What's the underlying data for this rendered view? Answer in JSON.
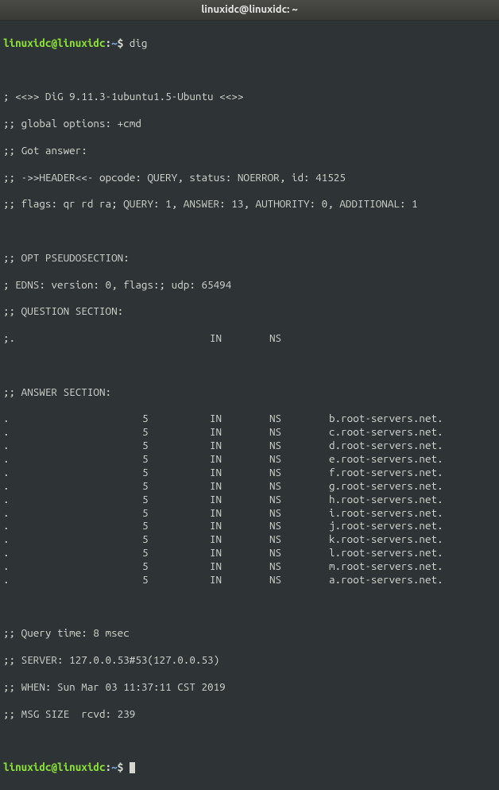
{
  "window": {
    "title": "linuxidc@linuxidc: ~"
  },
  "prompt": {
    "user_host": "linuxidc@linuxidc",
    "separator": ":",
    "path": "~",
    "symbol": "$ "
  },
  "command": "dig",
  "output": {
    "banner": "; <<>> DiG 9.11.3-1ubuntu1.5-Ubuntu <<>>",
    "global_options": ";; global options: +cmd",
    "got_answer": ";; Got answer:",
    "header": ";; ->>HEADER<<- opcode: QUERY, status: NOERROR, id: 41525",
    "flags": ";; flags: qr rd ra; QUERY: 1, ANSWER: 13, AUTHORITY: 0, ADDITIONAL: 1",
    "opt_header": ";; OPT PSEUDOSECTION:",
    "edns": "; EDNS: version: 0, flags:; udp: 65494",
    "question_header": ";; QUESTION SECTION:",
    "question_row": {
      "name": ";.",
      "class": "IN",
      "type": "NS"
    },
    "answer_header": ";; ANSWER SECTION:",
    "answers": [
      {
        "name": ".",
        "ttl": "5",
        "class": "IN",
        "type": "NS",
        "target": "b.root-servers.net."
      },
      {
        "name": ".",
        "ttl": "5",
        "class": "IN",
        "type": "NS",
        "target": "c.root-servers.net."
      },
      {
        "name": ".",
        "ttl": "5",
        "class": "IN",
        "type": "NS",
        "target": "d.root-servers.net."
      },
      {
        "name": ".",
        "ttl": "5",
        "class": "IN",
        "type": "NS",
        "target": "e.root-servers.net."
      },
      {
        "name": ".",
        "ttl": "5",
        "class": "IN",
        "type": "NS",
        "target": "f.root-servers.net."
      },
      {
        "name": ".",
        "ttl": "5",
        "class": "IN",
        "type": "NS",
        "target": "g.root-servers.net."
      },
      {
        "name": ".",
        "ttl": "5",
        "class": "IN",
        "type": "NS",
        "target": "h.root-servers.net."
      },
      {
        "name": ".",
        "ttl": "5",
        "class": "IN",
        "type": "NS",
        "target": "i.root-servers.net."
      },
      {
        "name": ".",
        "ttl": "5",
        "class": "IN",
        "type": "NS",
        "target": "j.root-servers.net."
      },
      {
        "name": ".",
        "ttl": "5",
        "class": "IN",
        "type": "NS",
        "target": "k.root-servers.net."
      },
      {
        "name": ".",
        "ttl": "5",
        "class": "IN",
        "type": "NS",
        "target": "l.root-servers.net."
      },
      {
        "name": ".",
        "ttl": "5",
        "class": "IN",
        "type": "NS",
        "target": "m.root-servers.net."
      },
      {
        "name": ".",
        "ttl": "5",
        "class": "IN",
        "type": "NS",
        "target": "a.root-servers.net."
      }
    ],
    "query_time": ";; Query time: 8 msec",
    "server": ";; SERVER: 127.0.0.53#53(127.0.0.53)",
    "when": ";; WHEN: Sun Mar 03 11:37:11 CST 2019",
    "msg_size": ";; MSG SIZE  rcvd: 239"
  }
}
